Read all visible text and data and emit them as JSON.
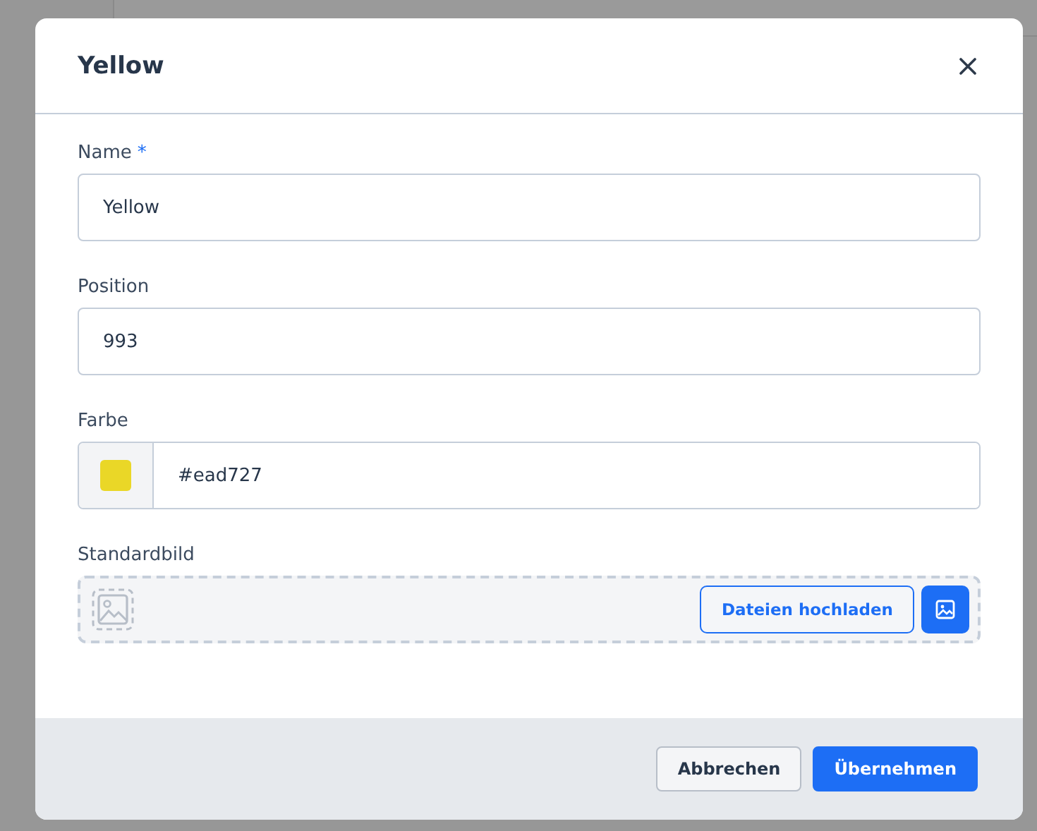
{
  "dialog": {
    "title": "Yellow",
    "fields": [
      {
        "kind": "text",
        "label": "Name",
        "required_mark": "*",
        "value": "Yellow"
      },
      {
        "kind": "text",
        "label": "Position",
        "value": "993"
      },
      {
        "kind": "color",
        "label": "Farbe",
        "value": "#ead727",
        "color": "#ead727"
      },
      {
        "kind": "image",
        "label": "Standardbild",
        "upload_button": "Dateien hochladen"
      }
    ],
    "buttons": [
      {
        "label": "Abbrechen",
        "kind": "secondary"
      },
      {
        "label": "Übernehmen",
        "kind": "primary"
      }
    ]
  }
}
